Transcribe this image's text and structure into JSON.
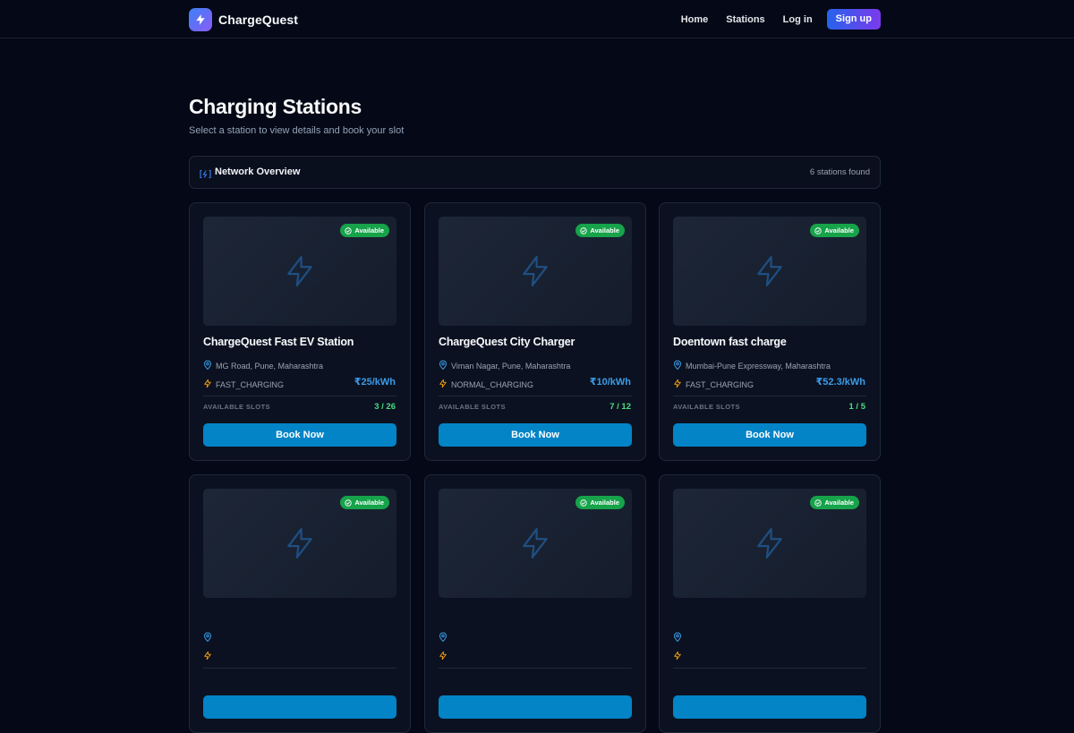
{
  "brand": {
    "name": "ChargeQuest",
    "logo_icon": "lightning-bolt-icon"
  },
  "nav": {
    "links": [
      "Home",
      "Stations",
      "Log in"
    ],
    "signup_label": "Sign up"
  },
  "page": {
    "title": "Charging Stations",
    "subtitle": "Select a station to view details and book your slot"
  },
  "overview": {
    "icon": "charging-station-icon",
    "title": "Network Overview",
    "count_text": "6 stations found"
  },
  "stations": [
    {
      "status": "Available",
      "name": "ChargeQuest Fast EV Station",
      "location": "MG Road, Pune, Maharashtra",
      "type": "FAST_CHARGING",
      "price": "₹25/kWh",
      "slots_label": "AVAILABLE SLOTS",
      "slots": "3 / 26",
      "book_label": "Book Now"
    },
    {
      "status": "Available",
      "name": "ChargeQuest City Charger",
      "location": "Viman Nagar, Pune, Maharashtra",
      "type": "NORMAL_CHARGING",
      "price": "₹10/kWh",
      "slots_label": "AVAILABLE SLOTS",
      "slots": "7 / 12",
      "book_label": "Book Now"
    },
    {
      "status": "Available",
      "name": "Doentown fast charge",
      "location": "Mumbai-Pune Expressway, Maharashtra",
      "type": "FAST_CHARGING",
      "price": "₹52.3/kWh",
      "slots_label": "AVAILABLE SLOTS",
      "slots": "1 / 5",
      "book_label": "Book Now"
    },
    {
      "status": "Available"
    },
    {
      "status": "Available"
    },
    {
      "status": "Available"
    }
  ],
  "colors": {
    "background": "#050816",
    "card": "#0b1120",
    "accent_button": "#0284c7",
    "price": "#3b9be8",
    "available_badge": "#16a34a",
    "slots": "#4ade80"
  }
}
